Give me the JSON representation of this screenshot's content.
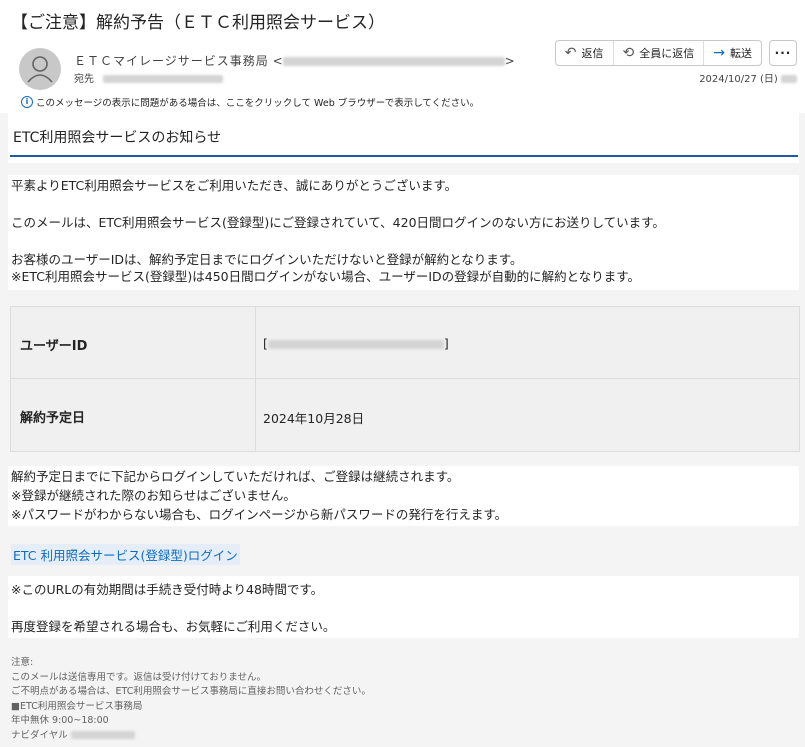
{
  "email": {
    "subject": "【ご注意】解約予告（ＥＴＣ利用照会サービス）",
    "sender_name": "ＥＴＣマイレージサービス事務局",
    "sender_open": "<",
    "sender_close": ">",
    "to_label": "宛先",
    "date": "2024/10/27 (日)",
    "info_text": "このメッセージの表示に問題がある場合は、ここをクリックして Web ブラウザーで表示してください。"
  },
  "actions": {
    "reply": "返信",
    "reply_all": "全員に返信",
    "forward": "転送",
    "more": "···"
  },
  "message": {
    "section_title": "ETC利用照会サービスのお知らせ",
    "p1": "平素よりETC利用照会サービスをご利用いただき、誠にありがとうございます。",
    "p2": "このメールは、ETC利用照会サービス(登録型)にご登録されていて、420日間ログインのない方にお送りしています。",
    "p3a": "お客様のユーザーIDは、解約予定日までにログインいただけないと登録が解約となります。",
    "p3b": "※ETC利用照会サービス(登録型)は450日間ログインがない場合、ユーザーIDの登録が自動的に解約となります。",
    "table": {
      "user_id_label": "ユーザーID",
      "cancel_date_label": "解約予定日",
      "cancel_date_value": "2024年10月28日"
    },
    "p4a": "解約予定日までに下記からログインしていただければ、ご登録は継続されます。",
    "p4b": "※登録が継続された際のお知らせはございません。",
    "p4c": "※パスワードがわからない場合も、ログインページから新パスワードの発行を行えます。",
    "login_link": "ETC 利用照会サービス(登録型)ログイン",
    "p5": "※このURLの有効期間は手続き受付時より48時間です。",
    "p6": "再度登録を希望される場合も、お気軽にご利用ください。"
  },
  "footer": {
    "l1": "注意:",
    "l2": "このメールは送信専用です。返信は受け付けておりません。",
    "l3": "ご不明点がある場合は、ETC利用照会サービス事務局に直接お問い合わせください。",
    "l4": "■ETC利用照会サービス事務局",
    "l5": "年中無休 9:00~18:00",
    "l6": "ナビダイヤル"
  }
}
